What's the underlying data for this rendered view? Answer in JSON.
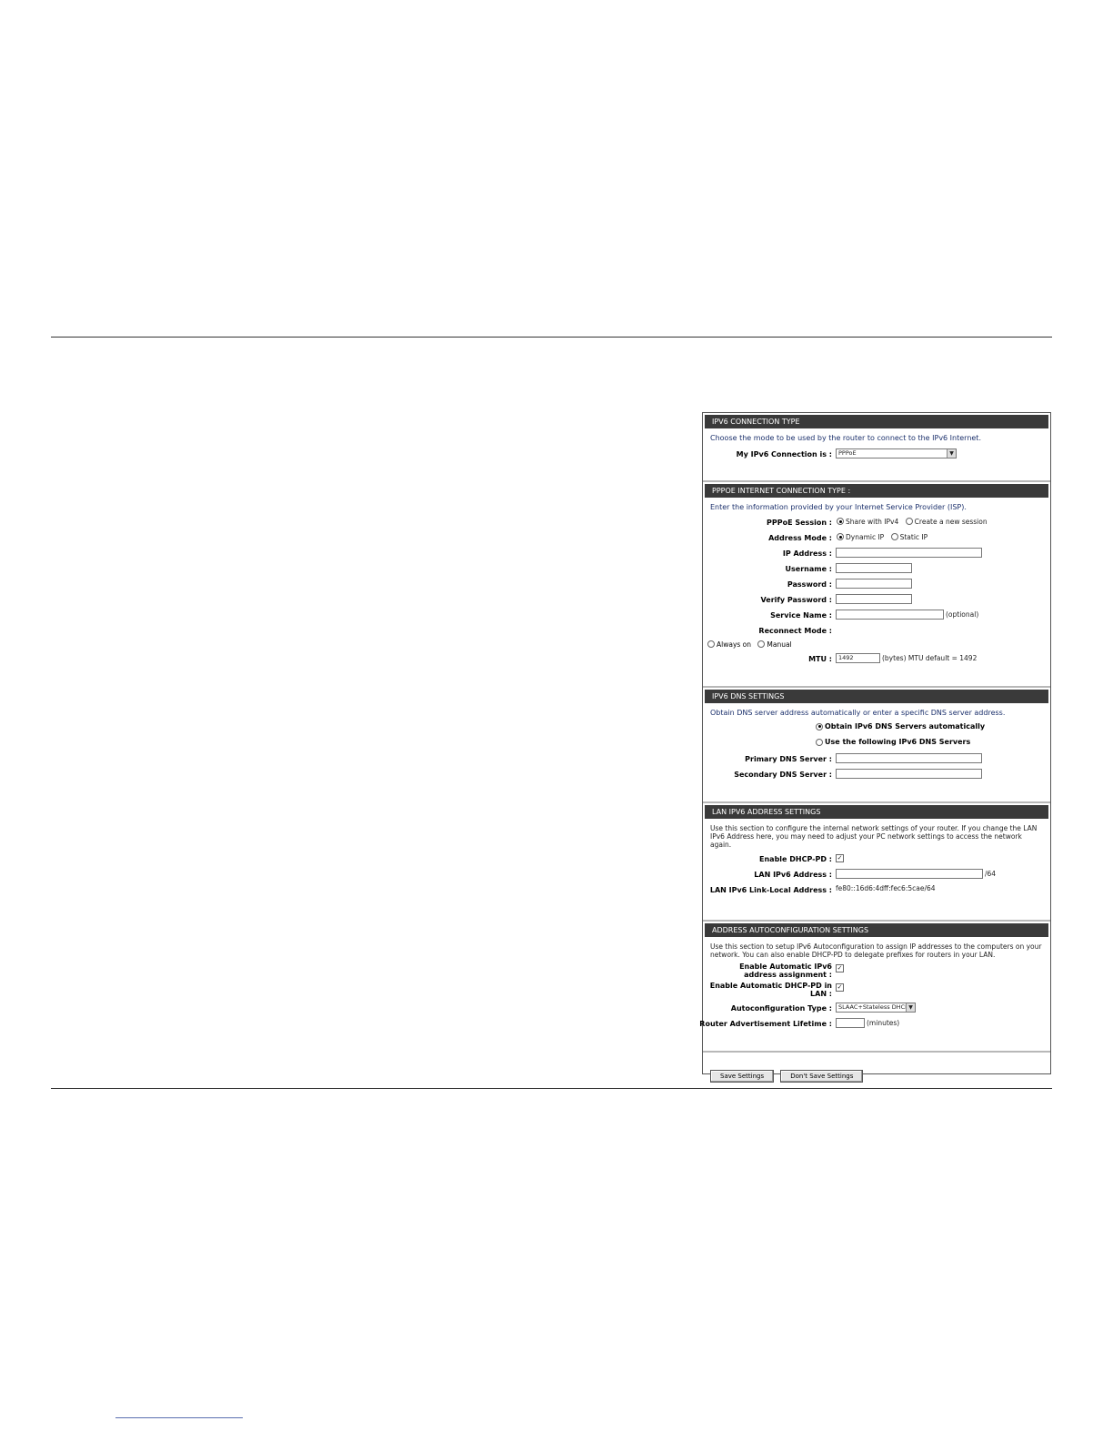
{
  "connection_type": {
    "header": "IPV6 CONNECTION TYPE",
    "intro": "Choose the mode to be used by the router to connect to the IPv6 Internet.",
    "label": "My IPv6 Connection is :",
    "selected": "PPPoE"
  },
  "pppoe": {
    "header": "PPPOE INTERNET CONNECTION TYPE :",
    "intro": "Enter the information provided by your Internet Service Provider (ISP).",
    "session_label": "PPPoE Session :",
    "session_opt1": "Share with IPv4",
    "session_opt2": "Create a new session",
    "address_mode_label": "Address Mode :",
    "address_opt1": "Dynamic IP",
    "address_opt2": "Static IP",
    "ip_label": "IP Address :",
    "username_label": "Username :",
    "password_label": "Password :",
    "verify_label": "Verify Password :",
    "service_label": "Service Name :",
    "service_hint": "(optional)",
    "reconnect_label": "Reconnect Mode :",
    "reconnect_opt1": "Always on",
    "reconnect_opt2": "Manual",
    "mtu_label": "MTU :",
    "mtu_value": "1492",
    "mtu_hint": "(bytes) MTU default = 1492"
  },
  "dns": {
    "header": "IPV6 DNS SETTINGS",
    "intro": "Obtain DNS server address automatically or enter a specific DNS server address.",
    "auto_label": "Obtain IPv6 DNS Servers automatically",
    "manual_label": "Use the following IPv6 DNS Servers",
    "primary_label": "Primary DNS Server :",
    "secondary_label": "Secondary DNS Server :"
  },
  "lan": {
    "header": "LAN IPV6 ADDRESS SETTINGS",
    "intro": "Use this section to configure the internal network settings of your router. If you change the LAN IPv6 Address here, you may need to adjust your PC network settings to access the network again.",
    "dhcp_pd_label": "Enable DHCP-PD :",
    "address_label": "LAN IPv6 Address :",
    "prefix_suffix": "/64",
    "link_local_label": "LAN IPv6 Link-Local Address :",
    "link_local_value": "fe80::16d6:4dff:fec6:5cae/64"
  },
  "autoconf": {
    "header": "ADDRESS AUTOCONFIGURATION SETTINGS",
    "intro": "Use this section to setup IPv6 Autoconfiguration to assign IP addresses to the computers on your network. You can also enable DHCP-PD to delegate prefixes for routers in your LAN.",
    "auto_assign_label": "Enable Automatic IPv6 address assignment :",
    "auto_dhcp_pd_label": "Enable Automatic DHCP-PD in LAN :",
    "type_label": "Autoconfiguration Type :",
    "type_value": "SLAAC+Stateless DHCP",
    "lifetime_label": "Router Advertisement Lifetime :",
    "lifetime_unit": "(minutes)"
  },
  "buttons": {
    "save": "Save Settings",
    "dont_save": "Don't Save Settings"
  }
}
